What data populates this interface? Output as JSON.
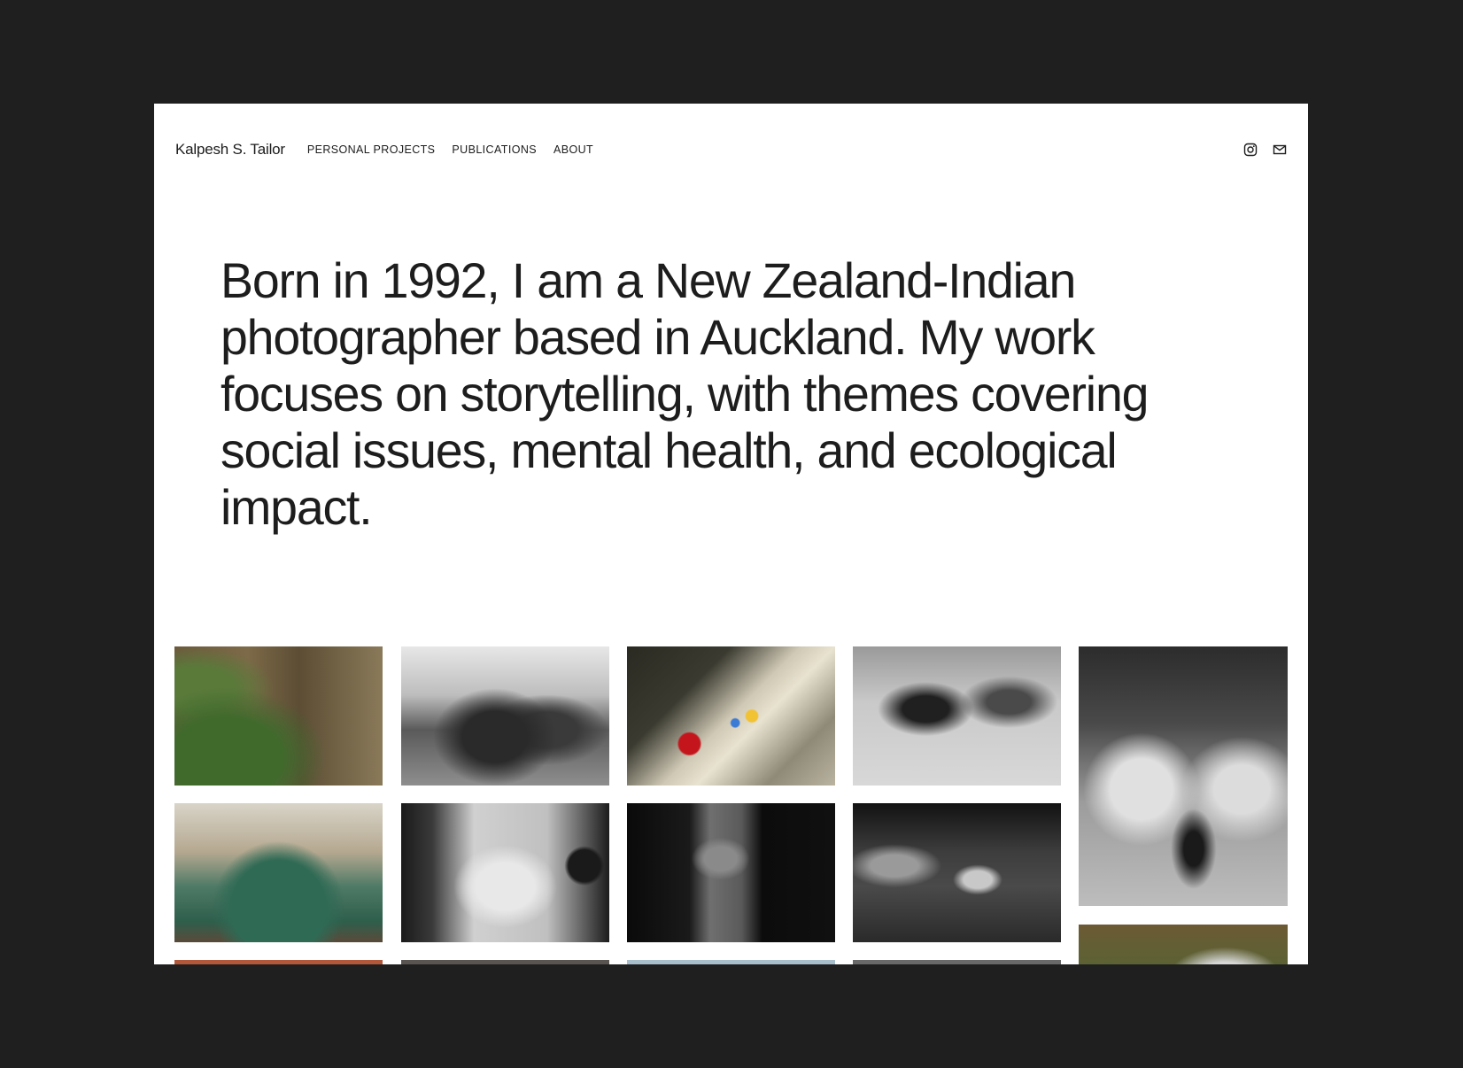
{
  "site": {
    "brand": "Kalpesh S. Tailor",
    "nav": [
      {
        "label": "PERSONAL PROJECTS"
      },
      {
        "label": "PUBLICATIONS"
      },
      {
        "label": "ABOUT"
      }
    ],
    "social": [
      "instagram-icon",
      "mail-icon"
    ]
  },
  "intro": {
    "text": "Born in 1992, I am a New Zealand-Indian photographer based in Auckland.  My work focuses on storytelling, with themes covering social issues, mental health, and ecological impact."
  },
  "gallery": {
    "photos": [
      {
        "name": "photo-stone-house-garden"
      },
      {
        "name": "photo-boys-market"
      },
      {
        "name": "photo-still-life-sunlight"
      },
      {
        "name": "photo-street-crowd-umbrella"
      },
      {
        "name": "photo-man-trucks"
      },
      {
        "name": "photo-green-truck"
      },
      {
        "name": "photo-rickshaw-woman"
      },
      {
        "name": "photo-dark-window"
      },
      {
        "name": "photo-market-boy"
      },
      {
        "name": "photo-street-color"
      },
      {
        "name": "photo-row3-1"
      },
      {
        "name": "photo-row3-2"
      },
      {
        "name": "photo-row3-3"
      },
      {
        "name": "photo-row3-4"
      }
    ]
  },
  "colors": {
    "background": "#1f1f1f",
    "page": "#ffffff",
    "text": "#1c1c1c"
  }
}
